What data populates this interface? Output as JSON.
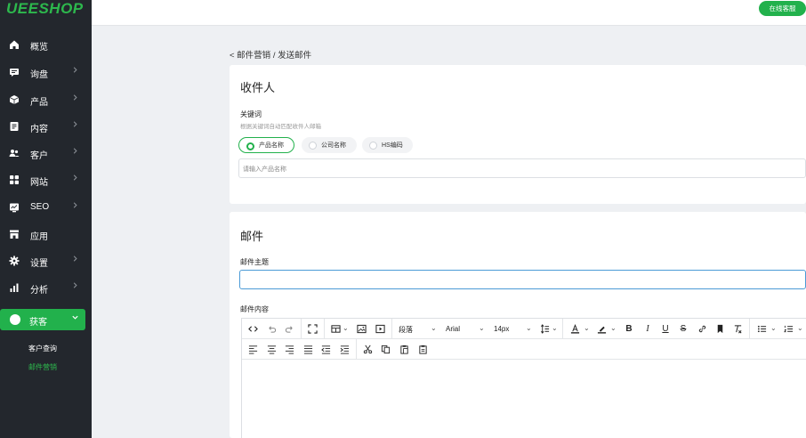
{
  "app": {
    "logo": "UEESHOP"
  },
  "sidebar": {
    "items": [
      {
        "label": "概览",
        "icon": "home-icon",
        "chevron": false
      },
      {
        "label": "询盘",
        "icon": "message-icon",
        "chevron": true
      },
      {
        "label": "产品",
        "icon": "box-icon",
        "chevron": true
      },
      {
        "label": "内容",
        "icon": "document-icon",
        "chevron": true
      },
      {
        "label": "客户",
        "icon": "users-icon",
        "chevron": true
      },
      {
        "label": "网站",
        "icon": "grid-icon",
        "chevron": true
      },
      {
        "label": "SEO",
        "icon": "chart-monitor-icon",
        "chevron": true
      },
      {
        "label": "应用",
        "icon": "store-icon",
        "chevron": false
      },
      {
        "label": "设置",
        "icon": "gear-icon",
        "chevron": true
      },
      {
        "label": "分析",
        "icon": "bar-chart-icon",
        "chevron": true
      }
    ],
    "active": {
      "label": "获客",
      "icon": "circle-icon"
    },
    "sub_items": [
      {
        "label": "客户查询",
        "active": false
      },
      {
        "label": "邮件营销",
        "active": true
      }
    ]
  },
  "topbar": {
    "help_label": "在线客服"
  },
  "breadcrumb": "< 邮件营销 / 发送邮件",
  "recipients": {
    "title": "收件人",
    "keyword_label": "关键词",
    "keyword_hint": "根据关键词自动匹配收件人邮箱",
    "options": [
      {
        "label": "产品名称",
        "selected": true
      },
      {
        "label": "公司名称",
        "selected": false
      },
      {
        "label": "HS编码",
        "selected": false
      }
    ],
    "input_placeholder": "请输入产品名称"
  },
  "mail": {
    "title": "邮件",
    "subject_label": "邮件主题",
    "subject_value": "",
    "content_label": "邮件内容",
    "toolbar": {
      "paragraph": "段落",
      "font": "Arial",
      "size": "14px"
    }
  },
  "colors": {
    "accent": "#22b14c",
    "sidebar_bg": "#23272d"
  }
}
